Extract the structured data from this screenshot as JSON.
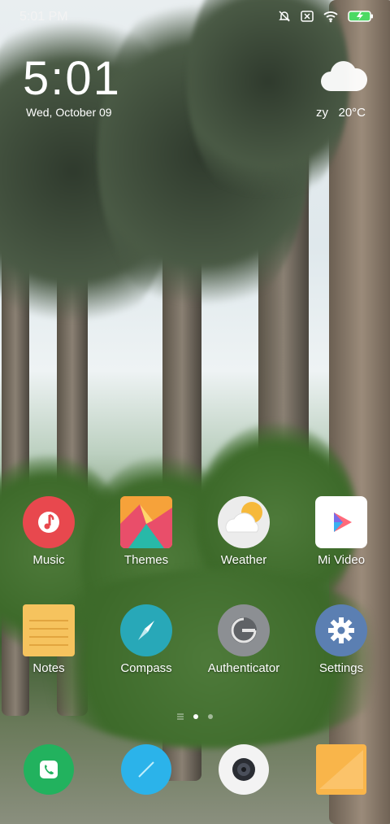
{
  "status_bar": {
    "time": "5:01 PM",
    "icons": [
      "notifications-off-icon",
      "sim-missing-icon",
      "wifi-icon",
      "battery-charging-icon"
    ]
  },
  "clock_widget": {
    "time": "5:01",
    "date": "Wed, October 09"
  },
  "weather_widget": {
    "condition": "zy",
    "temperature": "20°C",
    "icon": "cloud-icon"
  },
  "apps": {
    "row1": [
      {
        "label": "Music",
        "icon": "music-note-icon",
        "color": "#e8484e"
      },
      {
        "label": "Themes",
        "icon": "mountain-icon",
        "color": "#f4734b"
      },
      {
        "label": "Weather",
        "icon": "sun-cloud-icon",
        "color": "#f0f0f0"
      },
      {
        "label": "Mi Video",
        "icon": "play-icon",
        "color": "#ffffff"
      }
    ],
    "row2": [
      {
        "label": "Notes",
        "icon": "notepad-icon",
        "color": "#f6c35e"
      },
      {
        "label": "Compass",
        "icon": "compass-needle-icon",
        "color": "#28a8b8"
      },
      {
        "label": "Authenticator",
        "icon": "key-dial-icon",
        "color": "#8c8f93"
      },
      {
        "label": "Settings",
        "icon": "gear-icon",
        "color": "#5b7fb2"
      }
    ]
  },
  "page_indicator": {
    "pages": 2,
    "active": 1,
    "menu_icon": "menu-lines-icon"
  },
  "dock": [
    {
      "name": "Phone",
      "icon": "phone-icon",
      "color": "#22b25e"
    },
    {
      "name": "Messages",
      "icon": "message-icon",
      "color": "#2bb3ea"
    },
    {
      "name": "Camera",
      "icon": "camera-lens-icon",
      "color": "#f3f3f3"
    },
    {
      "name": "Gallery",
      "icon": "gallery-icon",
      "color": "#f9b54a"
    }
  ]
}
